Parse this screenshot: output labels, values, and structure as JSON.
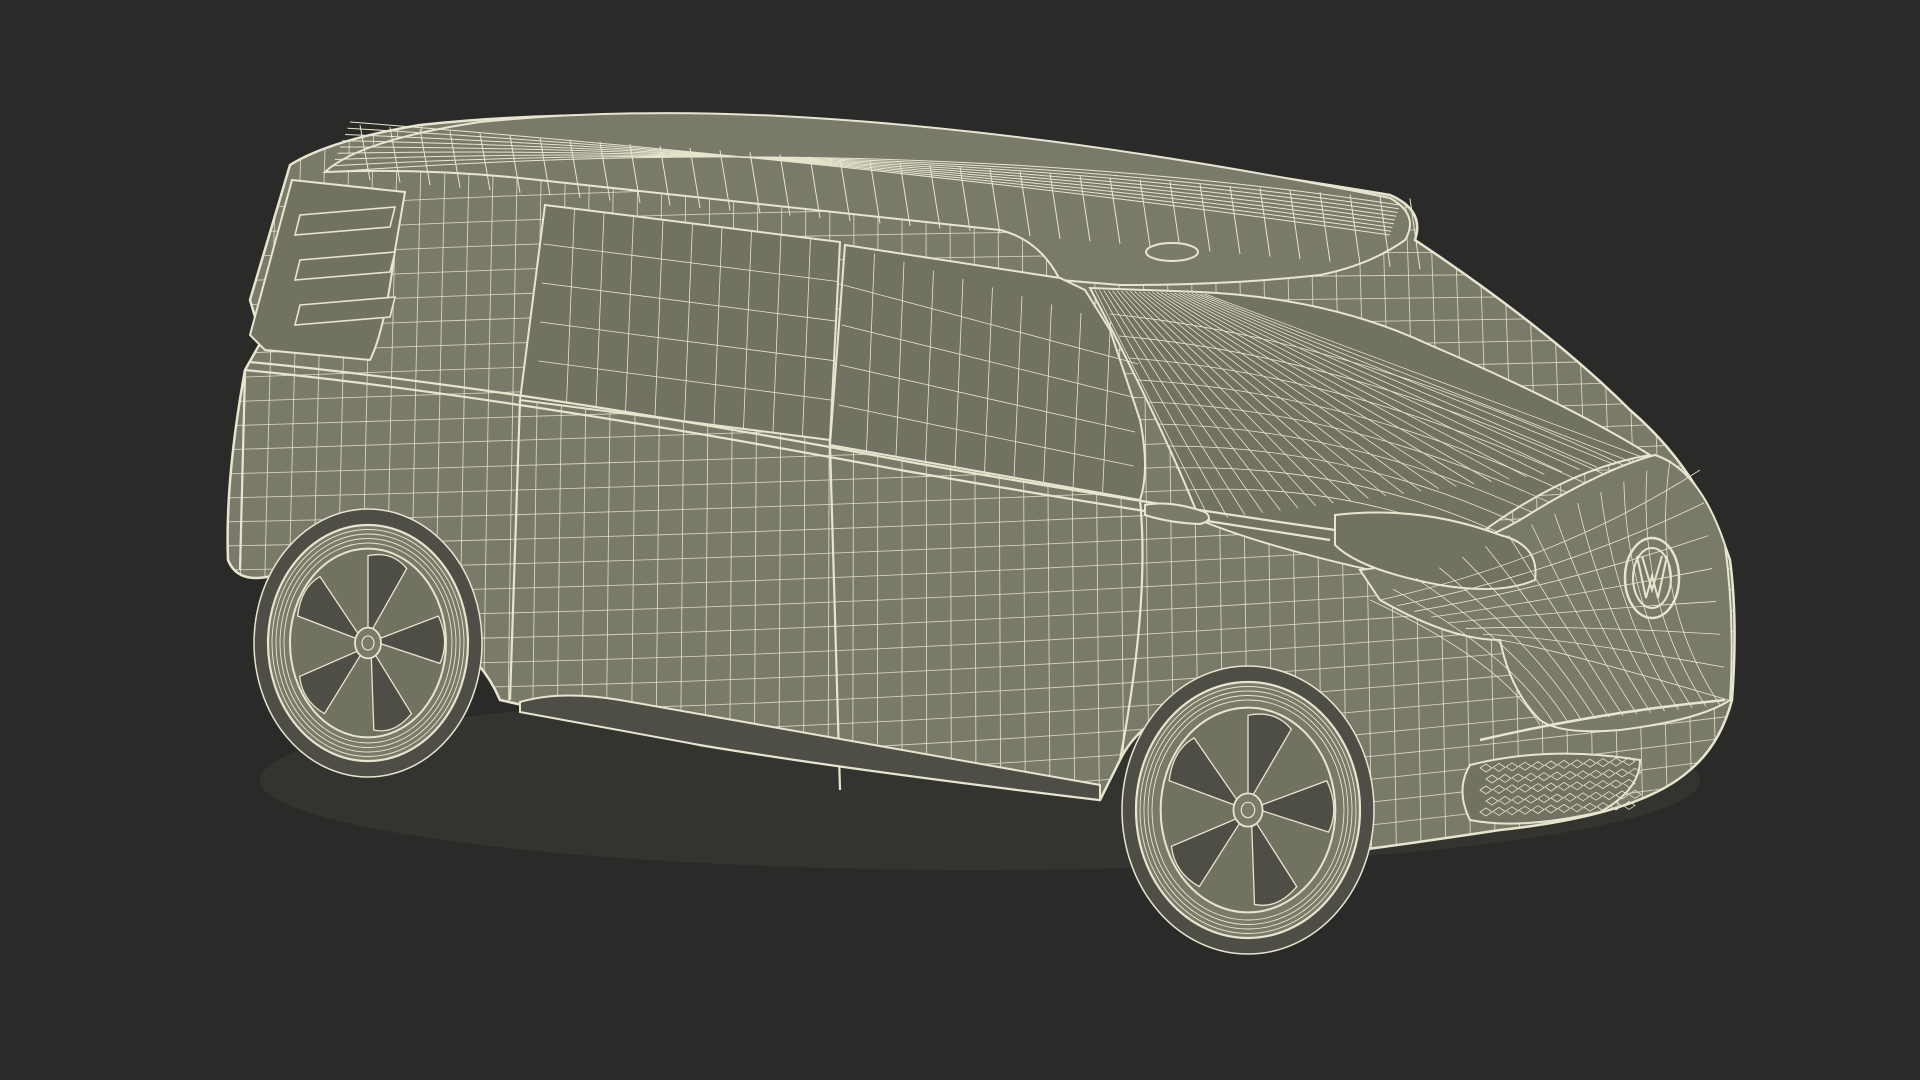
{
  "scene": {
    "background_color": "#2a2a28",
    "wire_color": "#e8e5cf",
    "body_fill": "#7a7a6a",
    "window_fill": "#727262",
    "shadow_fill": "#4e4e46",
    "subject": "wireframe-electric-van",
    "badge_text": "",
    "logo": "vw-logo-icon"
  }
}
